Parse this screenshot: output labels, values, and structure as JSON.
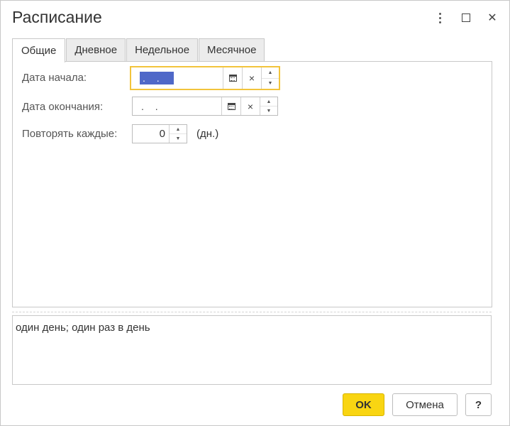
{
  "window": {
    "title": "Расписание",
    "controls": {
      "more_icon": "more-vertical-icon",
      "maximize_icon": "maximize-icon",
      "close_glyph": "✕"
    }
  },
  "tabs": [
    {
      "label": "Общие",
      "active": true
    },
    {
      "label": "Дневное",
      "active": false
    },
    {
      "label": "Недельное",
      "active": false
    },
    {
      "label": "Месячное",
      "active": false
    }
  ],
  "general": {
    "start_date": {
      "label": "Дата начала:",
      "value": ". ."
    },
    "end_date": {
      "label": "Дата окончания:",
      "value": ". ."
    },
    "repeat": {
      "label": "Повторять каждые:",
      "value": "0",
      "unit": "(дн.)"
    },
    "clear_glyph": "×",
    "spin_up": "▲",
    "spin_down": "▼"
  },
  "summary": "один день; один раз в день",
  "buttons": {
    "ok": "OK",
    "cancel": "Отмена",
    "help": "?"
  },
  "colors": {
    "accent_ok": "#f9d512",
    "focus_border": "#f2c43c",
    "selection": "#4f68c8"
  }
}
